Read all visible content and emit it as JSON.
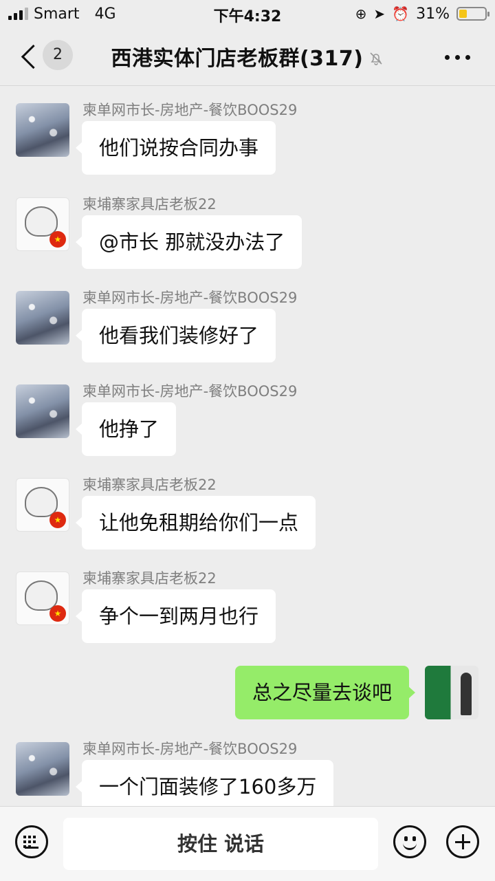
{
  "status_bar": {
    "carrier": "Smart",
    "network": "4G",
    "time": "下午4:32",
    "battery_percent": "31%",
    "battery_level": 0.31,
    "icons": [
      "signal-icon",
      "lock-rotation-icon",
      "location-icon",
      "alarm-icon",
      "battery-icon"
    ]
  },
  "nav": {
    "unread_count": "2",
    "title": "西港实体门店老板群(317)",
    "muted_icon": "bell-slash-icon",
    "more_icon": "ellipsis-icon"
  },
  "messages": [
    {
      "sender": "柬单网市长-房地产-餐饮BOOS29",
      "text": "他们说按合同办事",
      "side": "left",
      "avatar": "snow-landscape"
    },
    {
      "sender": "柬埔寨家具店老板22",
      "text": "@市长 那就没办法了",
      "side": "left",
      "avatar": "anime-boy-china-flag"
    },
    {
      "sender": "柬单网市长-房地产-餐饮BOOS29",
      "text": "他看我们装修好了",
      "side": "left",
      "avatar": "snow-landscape"
    },
    {
      "sender": "柬单网市长-房地产-餐饮BOOS29",
      "text": "他挣了",
      "side": "left",
      "avatar": "snow-landscape"
    },
    {
      "sender": "柬埔寨家具店老板22",
      "text": "让他免租期给你们一点",
      "side": "left",
      "avatar": "anime-boy-china-flag"
    },
    {
      "sender": "柬埔寨家具店老板22",
      "text": "争个一到两月也行",
      "side": "left",
      "avatar": "anime-boy-china-flag"
    },
    {
      "sender": "",
      "text": "总之尽量去谈吧",
      "side": "right",
      "avatar": "green-business-card"
    },
    {
      "sender": "柬单网市长-房地产-餐饮BOOS29",
      "text": "一个门面装修了160多万",
      "side": "left",
      "avatar": "snow-landscape"
    }
  ],
  "bottom_bar": {
    "voice_label": "按住 说话",
    "icons": [
      "keyboard-icon",
      "emoji-icon",
      "plus-icon"
    ]
  },
  "colors": {
    "background": "#ededed",
    "bubble_self": "#95ec69",
    "bubble_other": "#ffffff",
    "battery": "#f5c518"
  }
}
